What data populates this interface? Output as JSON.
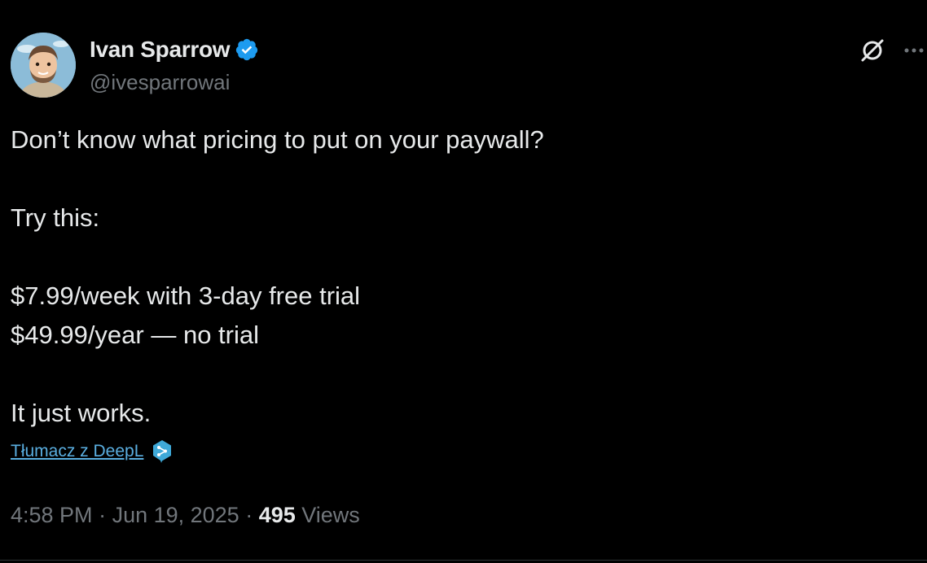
{
  "author": {
    "display_name": "Ivan Sparrow",
    "handle": "@ivesparrowai",
    "verified": true
  },
  "actions": {
    "grok_icon": "grok-icon",
    "more_icon": "more-horizontal-icon"
  },
  "tweet": {
    "lines": [
      "Don’t know what pricing to put on your paywall?",
      "",
      "Try this:",
      "",
      "$7.99/week with 3-day free trial",
      "$49.99/year — no trial",
      "",
      "It just works."
    ]
  },
  "translate": {
    "label": "Tłumacz z DeepL",
    "icon": "deepl-icon"
  },
  "meta": {
    "time": "4:58 PM",
    "separator": " · ",
    "date": "Jun 19, 2025",
    "views_count": "495",
    "views_label": " Views"
  },
  "colors": {
    "background": "#000000",
    "text": "#e7e9ea",
    "secondary": "#71767b",
    "link": "#5aaee0",
    "verified": "#1d9bf0"
  }
}
